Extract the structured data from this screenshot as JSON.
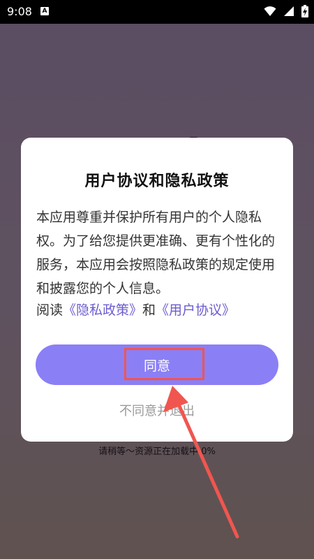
{
  "status_bar": {
    "time": "9:08",
    "notification_icon": "A",
    "icons": [
      "wifi-icon",
      "signal-icon",
      "battery-charging-icon"
    ]
  },
  "dialog": {
    "title": "用户协议和隐私政策",
    "body": "本应用尊重并保护所有用户的个人隐私权。为了给您提供更准确、更有个性化的服务，本应用会按照隐私政策的规定使用和披露您的个人信息。",
    "read_prefix": "阅读",
    "privacy_link": "《隐私政策》",
    "and_text": "和",
    "agreement_link": "《用户协议》",
    "agree_label": "同意",
    "disagree_label": "不同意并退出"
  },
  "loading": {
    "text": "请稍等～资源正在加载中 0%"
  },
  "colors": {
    "accent": "#8b7ff5",
    "link": "#6b5ccf",
    "annotation": "#f0564f"
  }
}
